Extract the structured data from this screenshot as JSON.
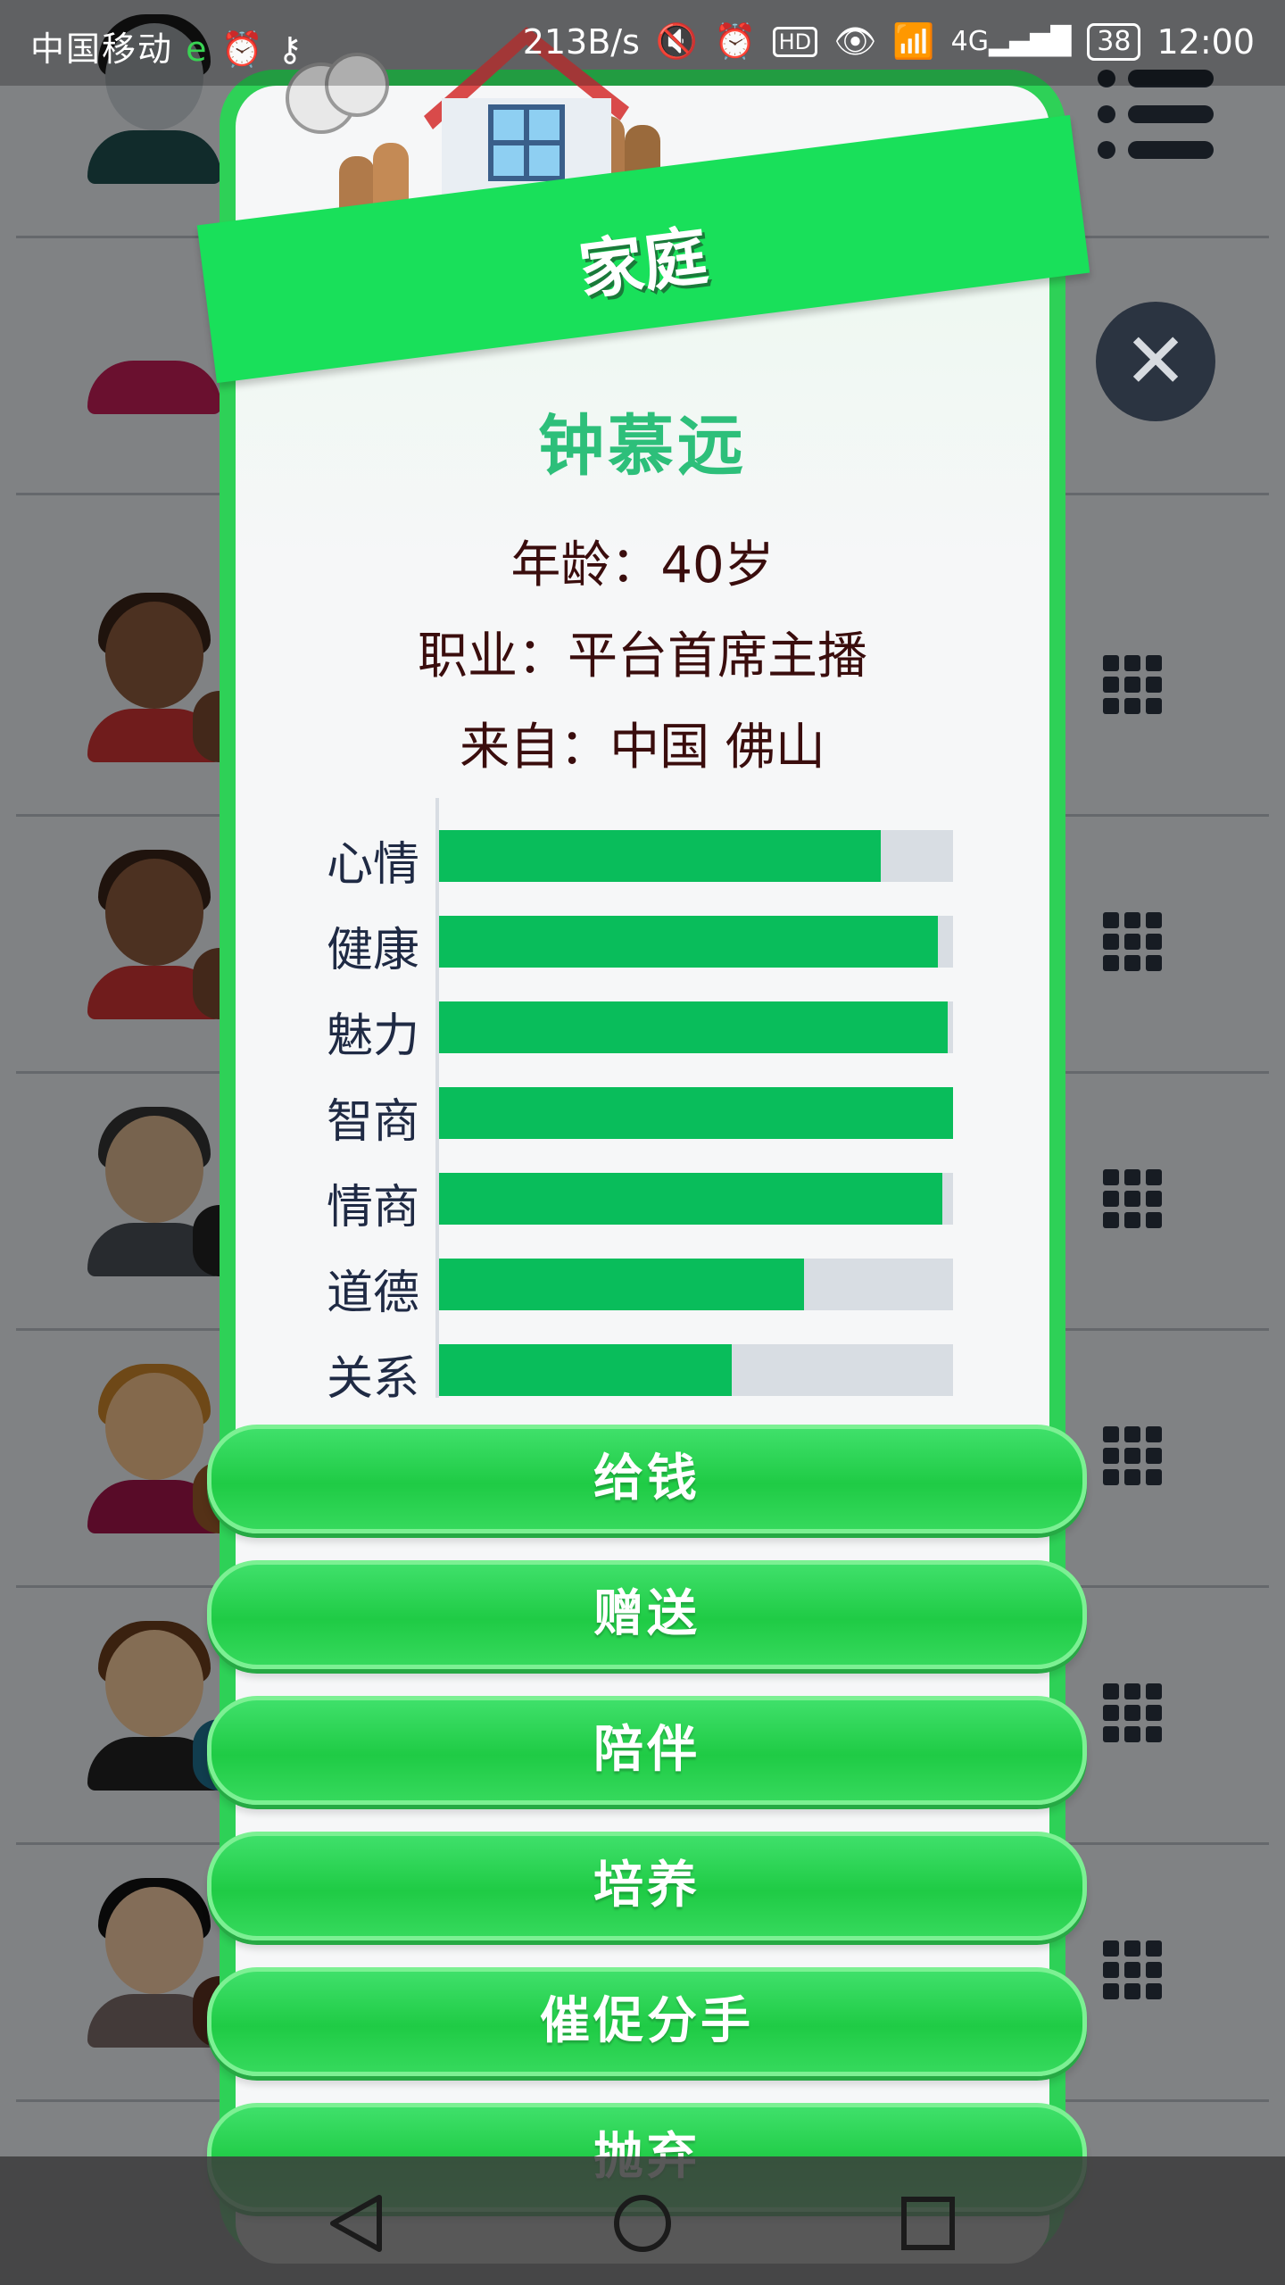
{
  "status_bar": {
    "carrier": "中国移动",
    "net_speed": "213B/s",
    "battery": "38",
    "time": "12:00",
    "icons": [
      "browser-e-icon",
      "alarm-icon",
      "key-icon",
      "mute-icon",
      "alarm-icon",
      "hd-icon",
      "eye-icon",
      "wifi-icon",
      "signal-4g-icon",
      "battery-icon"
    ]
  },
  "dialog": {
    "banner_title": "家庭",
    "name": "钟慕远",
    "age_label": "年龄：",
    "age_value": "40岁",
    "job_label": "职业：",
    "job_value": "平台首席主播",
    "from_label": "来自：",
    "from_value": "中国 佛山",
    "stats": [
      {
        "label": "心情",
        "value": 0.86
      },
      {
        "label": "健康",
        "value": 0.97
      },
      {
        "label": "魅力",
        "value": 0.99
      },
      {
        "label": "智商",
        "value": 1.0
      },
      {
        "label": "情商",
        "value": 0.98
      },
      {
        "label": "道德",
        "value": 0.71
      },
      {
        "label": "关系",
        "value": 0.57
      }
    ],
    "actions": [
      "给钱",
      "赠送",
      "陪伴",
      "培养",
      "催促分手",
      "抛弃"
    ]
  },
  "colors": {
    "accent": "#2ed157",
    "banner": "#19e05a",
    "name": "#2dbf7a",
    "stat_fill": "#09bd5b",
    "stat_track": "#d8dde3"
  },
  "nav": {
    "icons": [
      "back-icon",
      "home-icon",
      "recents-icon"
    ]
  }
}
